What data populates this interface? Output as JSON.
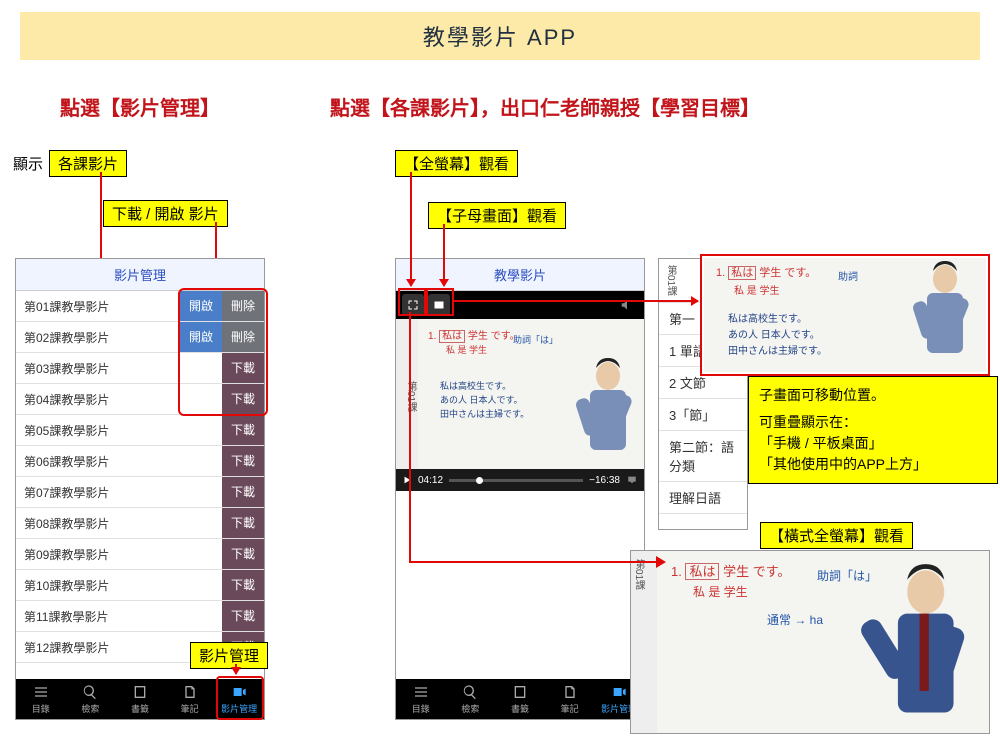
{
  "title": "教學影片 APP",
  "left_heading": "點選【影片管理】",
  "right_heading": "點選【各課影片】，出口仁老師親授【學習目標】",
  "display_label": "顯示",
  "lessons_label": "各課影片",
  "dl_open_label": "下載 / 開啟 影片",
  "fullscreen_label": "【全螢幕】觀看",
  "pip_label": "【子母畫面】觀看",
  "landscape_label": "【橫式全螢幕】觀看",
  "video_manage_label": "影片管理",
  "phone1_header": "影片管理",
  "phone2_header": "教學影片",
  "open_btn": "開啟",
  "del_btn": "刪除",
  "dl_btn": "下載",
  "list": {
    "items": [
      {
        "name": "第01課教學影片",
        "mode": "open"
      },
      {
        "name": "第02課教學影片",
        "mode": "open"
      },
      {
        "name": "第03課教學影片",
        "mode": "dl"
      },
      {
        "name": "第04課教學影片",
        "mode": "dl"
      },
      {
        "name": "第05課教學影片",
        "mode": "dl"
      },
      {
        "name": "第06課教學影片",
        "mode": "dl"
      },
      {
        "name": "第07課教學影片",
        "mode": "dl"
      },
      {
        "name": "第08課教學影片",
        "mode": "dl"
      },
      {
        "name": "第09課教學影片",
        "mode": "dl"
      },
      {
        "name": "第10課教學影片",
        "mode": "dl"
      },
      {
        "name": "第11課教學影片",
        "mode": "dl"
      },
      {
        "name": "第12課教學影片",
        "mode": "dl"
      }
    ]
  },
  "tabs": {
    "t0": "目錄",
    "t1": "檢索",
    "t2": "書籤",
    "t3": "筆記",
    "t4": "影片管理"
  },
  "player": {
    "elapsed": "04:12",
    "remaining": "−16:38"
  },
  "side_lesson": "第01課",
  "side_first": "第一",
  "right_rows": {
    "r0": "1 單語",
    "r1": "2 文節",
    "r2": "3「節」",
    "r3": "第二節：語分類",
    "r4": "理解日語"
  },
  "yellow_panel": {
    "l0": "子畫面可移動位置。",
    "l1": "可重疊顯示在：",
    "l2": "「手機 / 平板桌面」",
    "l3": "「其他使用中的APP上方」"
  }
}
